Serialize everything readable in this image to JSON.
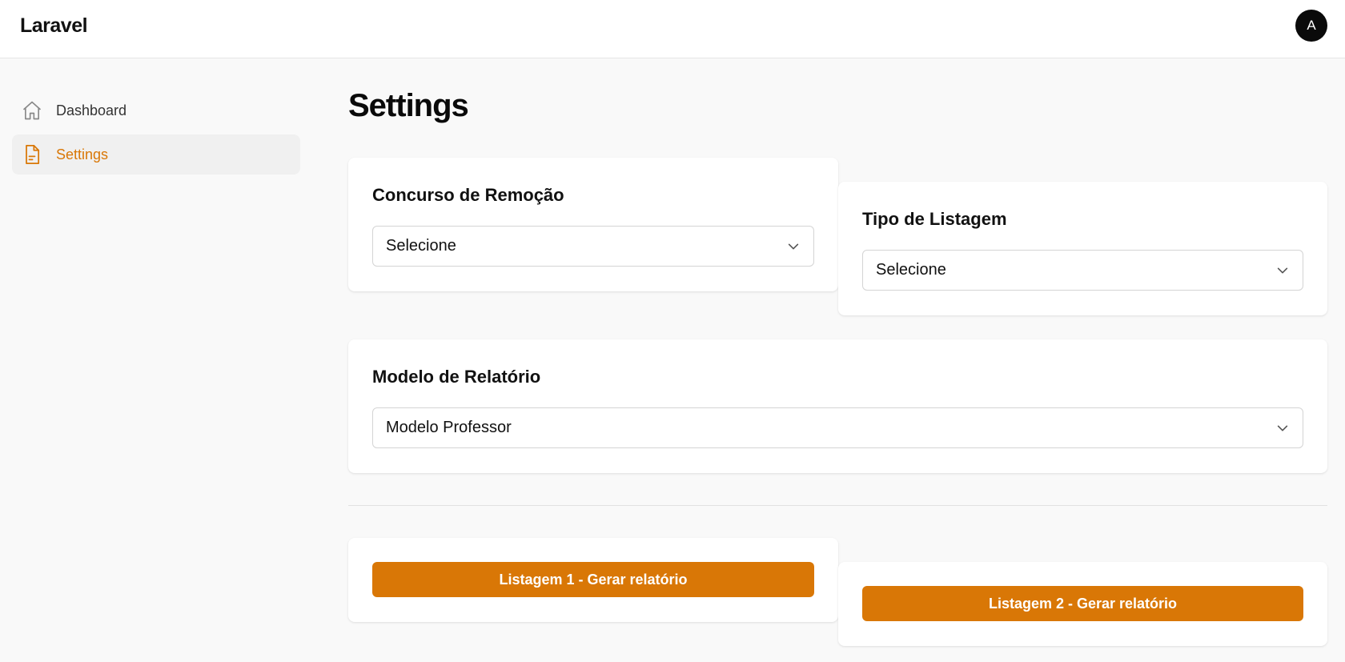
{
  "header": {
    "brand": "Laravel",
    "avatar_initial": "A"
  },
  "sidebar": {
    "items": [
      {
        "label": "Dashboard",
        "icon": "home-icon",
        "active": false
      },
      {
        "label": "Settings",
        "icon": "document-icon",
        "active": true
      }
    ]
  },
  "main": {
    "title": "Settings",
    "concurso": {
      "title": "Concurso de Remoção",
      "value": "Selecione"
    },
    "tipo": {
      "title": "Tipo de Listagem",
      "value": "Selecione"
    },
    "modelo": {
      "title": "Modelo de Relatório",
      "value": "Modelo Professor"
    },
    "buttons": {
      "listagem1": "Listagem 1 - Gerar relatório",
      "listagem2": "Listagem 2 - Gerar relatório"
    }
  },
  "colors": {
    "accent": "#d97706",
    "background": "#f9f9f9",
    "card": "#ffffff",
    "text": "#111111"
  }
}
